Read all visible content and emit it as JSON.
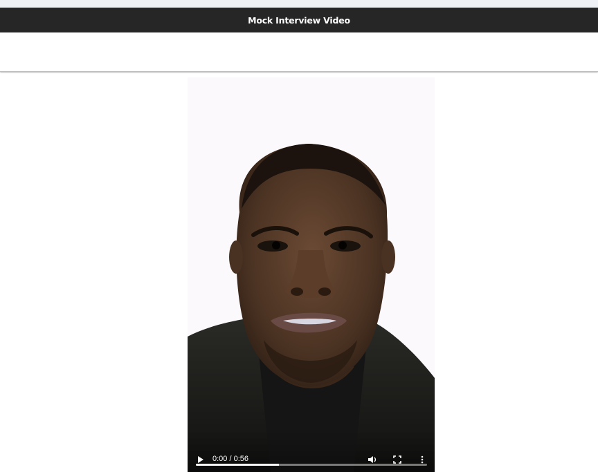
{
  "page": {
    "title": "Mock Interview Video"
  },
  "video": {
    "current_time": "0:00",
    "separator": " / ",
    "duration": "0:56",
    "progress_fraction": 0.36,
    "controls": {
      "play_icon": "play-icon",
      "volume_icon": "volume-icon",
      "fullscreen_icon": "fullscreen-icon",
      "more_icon": "more-options-icon"
    }
  },
  "colors": {
    "title_bar": "#262626",
    "title_text": "#ffffff",
    "page_background": "#ffffff",
    "video_background": "#fbf9fb"
  }
}
